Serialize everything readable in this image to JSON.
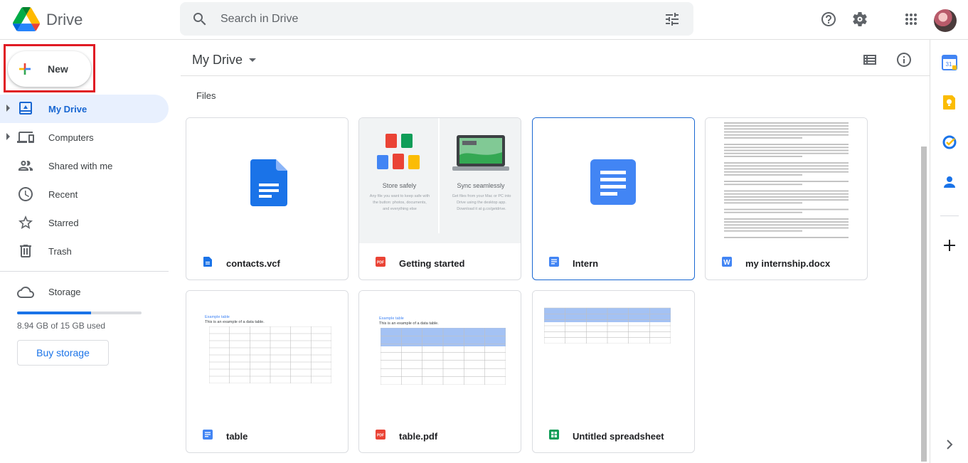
{
  "app": {
    "name": "Drive"
  },
  "search": {
    "placeholder": "Search in Drive"
  },
  "sidebar": {
    "new_label": "New",
    "items": [
      {
        "label": "My Drive",
        "icon": "my-drive-icon",
        "active": true,
        "expandable": true
      },
      {
        "label": "Computers",
        "icon": "computers-icon",
        "active": false,
        "expandable": true
      },
      {
        "label": "Shared with me",
        "icon": "shared-icon",
        "active": false,
        "expandable": false
      },
      {
        "label": "Recent",
        "icon": "clock-icon",
        "active": false,
        "expandable": false
      },
      {
        "label": "Starred",
        "icon": "star-icon",
        "active": false,
        "expandable": false
      },
      {
        "label": "Trash",
        "icon": "trash-icon",
        "active": false,
        "expandable": false
      }
    ],
    "storage": {
      "label": "Storage",
      "used_text": "8.94 GB of 15 GB used",
      "used_fraction": 0.596,
      "buy_label": "Buy storage"
    }
  },
  "main": {
    "title": "My Drive",
    "section": "Files",
    "files": [
      {
        "name": "contacts.vcf",
        "type": "doc",
        "thumb": "doc-icon"
      },
      {
        "name": "Getting started",
        "type": "pdf",
        "thumb": "getting-started"
      },
      {
        "name": "Intern",
        "type": "gdoc",
        "thumb": "gdoc-icon",
        "selected": true
      },
      {
        "name": "my internship.docx",
        "type": "word",
        "thumb": "text-page"
      },
      {
        "name": "table",
        "type": "gdoc",
        "thumb": "table-doc"
      },
      {
        "name": "table.pdf",
        "type": "pdf",
        "thumb": "table-doc"
      },
      {
        "name": "Untitled spreadsheet",
        "type": "sheet",
        "thumb": "sheet"
      }
    ]
  },
  "getting_started": {
    "left_title": "Store safely",
    "left_text": "Any file you want to keep safe with the  button: photos, documents, and everything else",
    "right_title": "Sync seamlessly",
    "right_text": "Get files from your Mac or PC into Drive using the desktop app. Download it at g.co/getdrive."
  },
  "table_thumb": {
    "heading": "Example table",
    "caption": "This is an example of a data table."
  },
  "colors": {
    "accent": "#1a73e8",
    "highlight_box": "#e01b24",
    "active_nav_bg": "#e8f0fe",
    "doc_blue": "#4285f4",
    "pdf_red": "#ea4335",
    "sheet_green": "#0f9d58"
  },
  "right_panel": {
    "icons": [
      "calendar-icon",
      "keep-icon",
      "tasks-icon",
      "contacts-icon",
      "add-icon",
      "expand-icon"
    ],
    "calendar_day": "31"
  }
}
